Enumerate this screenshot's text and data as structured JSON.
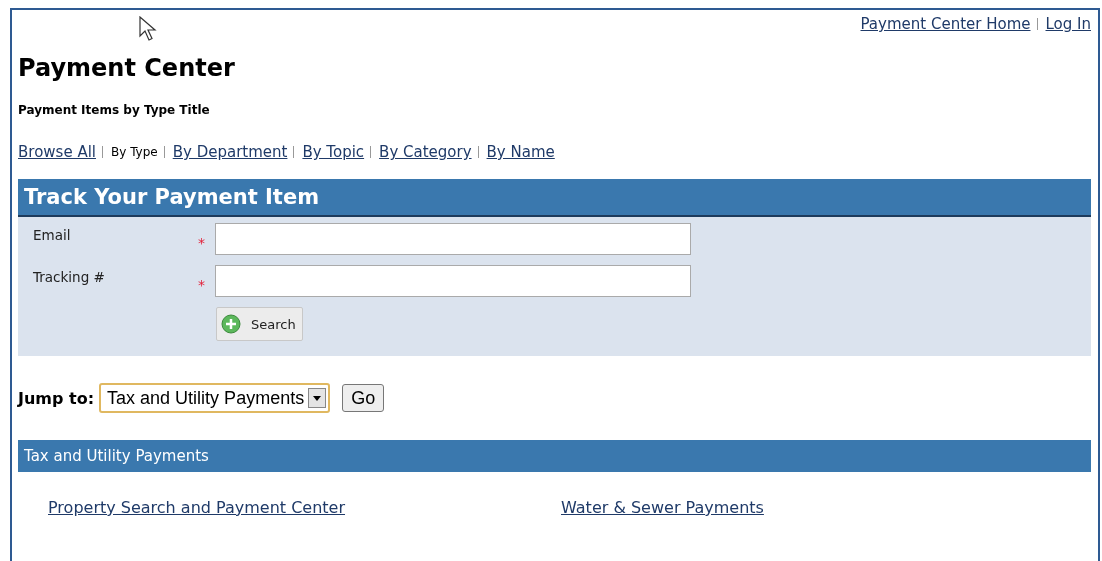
{
  "top_links": [
    "Payment Center Home",
    "Log In"
  ],
  "title": "Payment Center",
  "subtitle": "Payment Items by Type Title",
  "nav": [
    {
      "label": "Browse All",
      "selected": false
    },
    {
      "label": "By Type",
      "selected": true
    },
    {
      "label": "By Department",
      "selected": false
    },
    {
      "label": "By Topic",
      "selected": false
    },
    {
      "label": "By Category",
      "selected": false
    },
    {
      "label": "By Name",
      "selected": false
    }
  ],
  "track": {
    "heading": "Track Your Payment Item",
    "fields": [
      {
        "label": "Email",
        "required": true
      },
      {
        "label": "Tracking #",
        "required": true
      }
    ],
    "required_mark": "*",
    "button": "Search"
  },
  "jump": {
    "label": "Jump to:",
    "value": "Tax and Utility Payments",
    "button": "Go"
  },
  "section": {
    "heading": "Tax and Utility Payments",
    "links": [
      "Property Search and Payment Center",
      "Water & Sewer Payments"
    ]
  }
}
